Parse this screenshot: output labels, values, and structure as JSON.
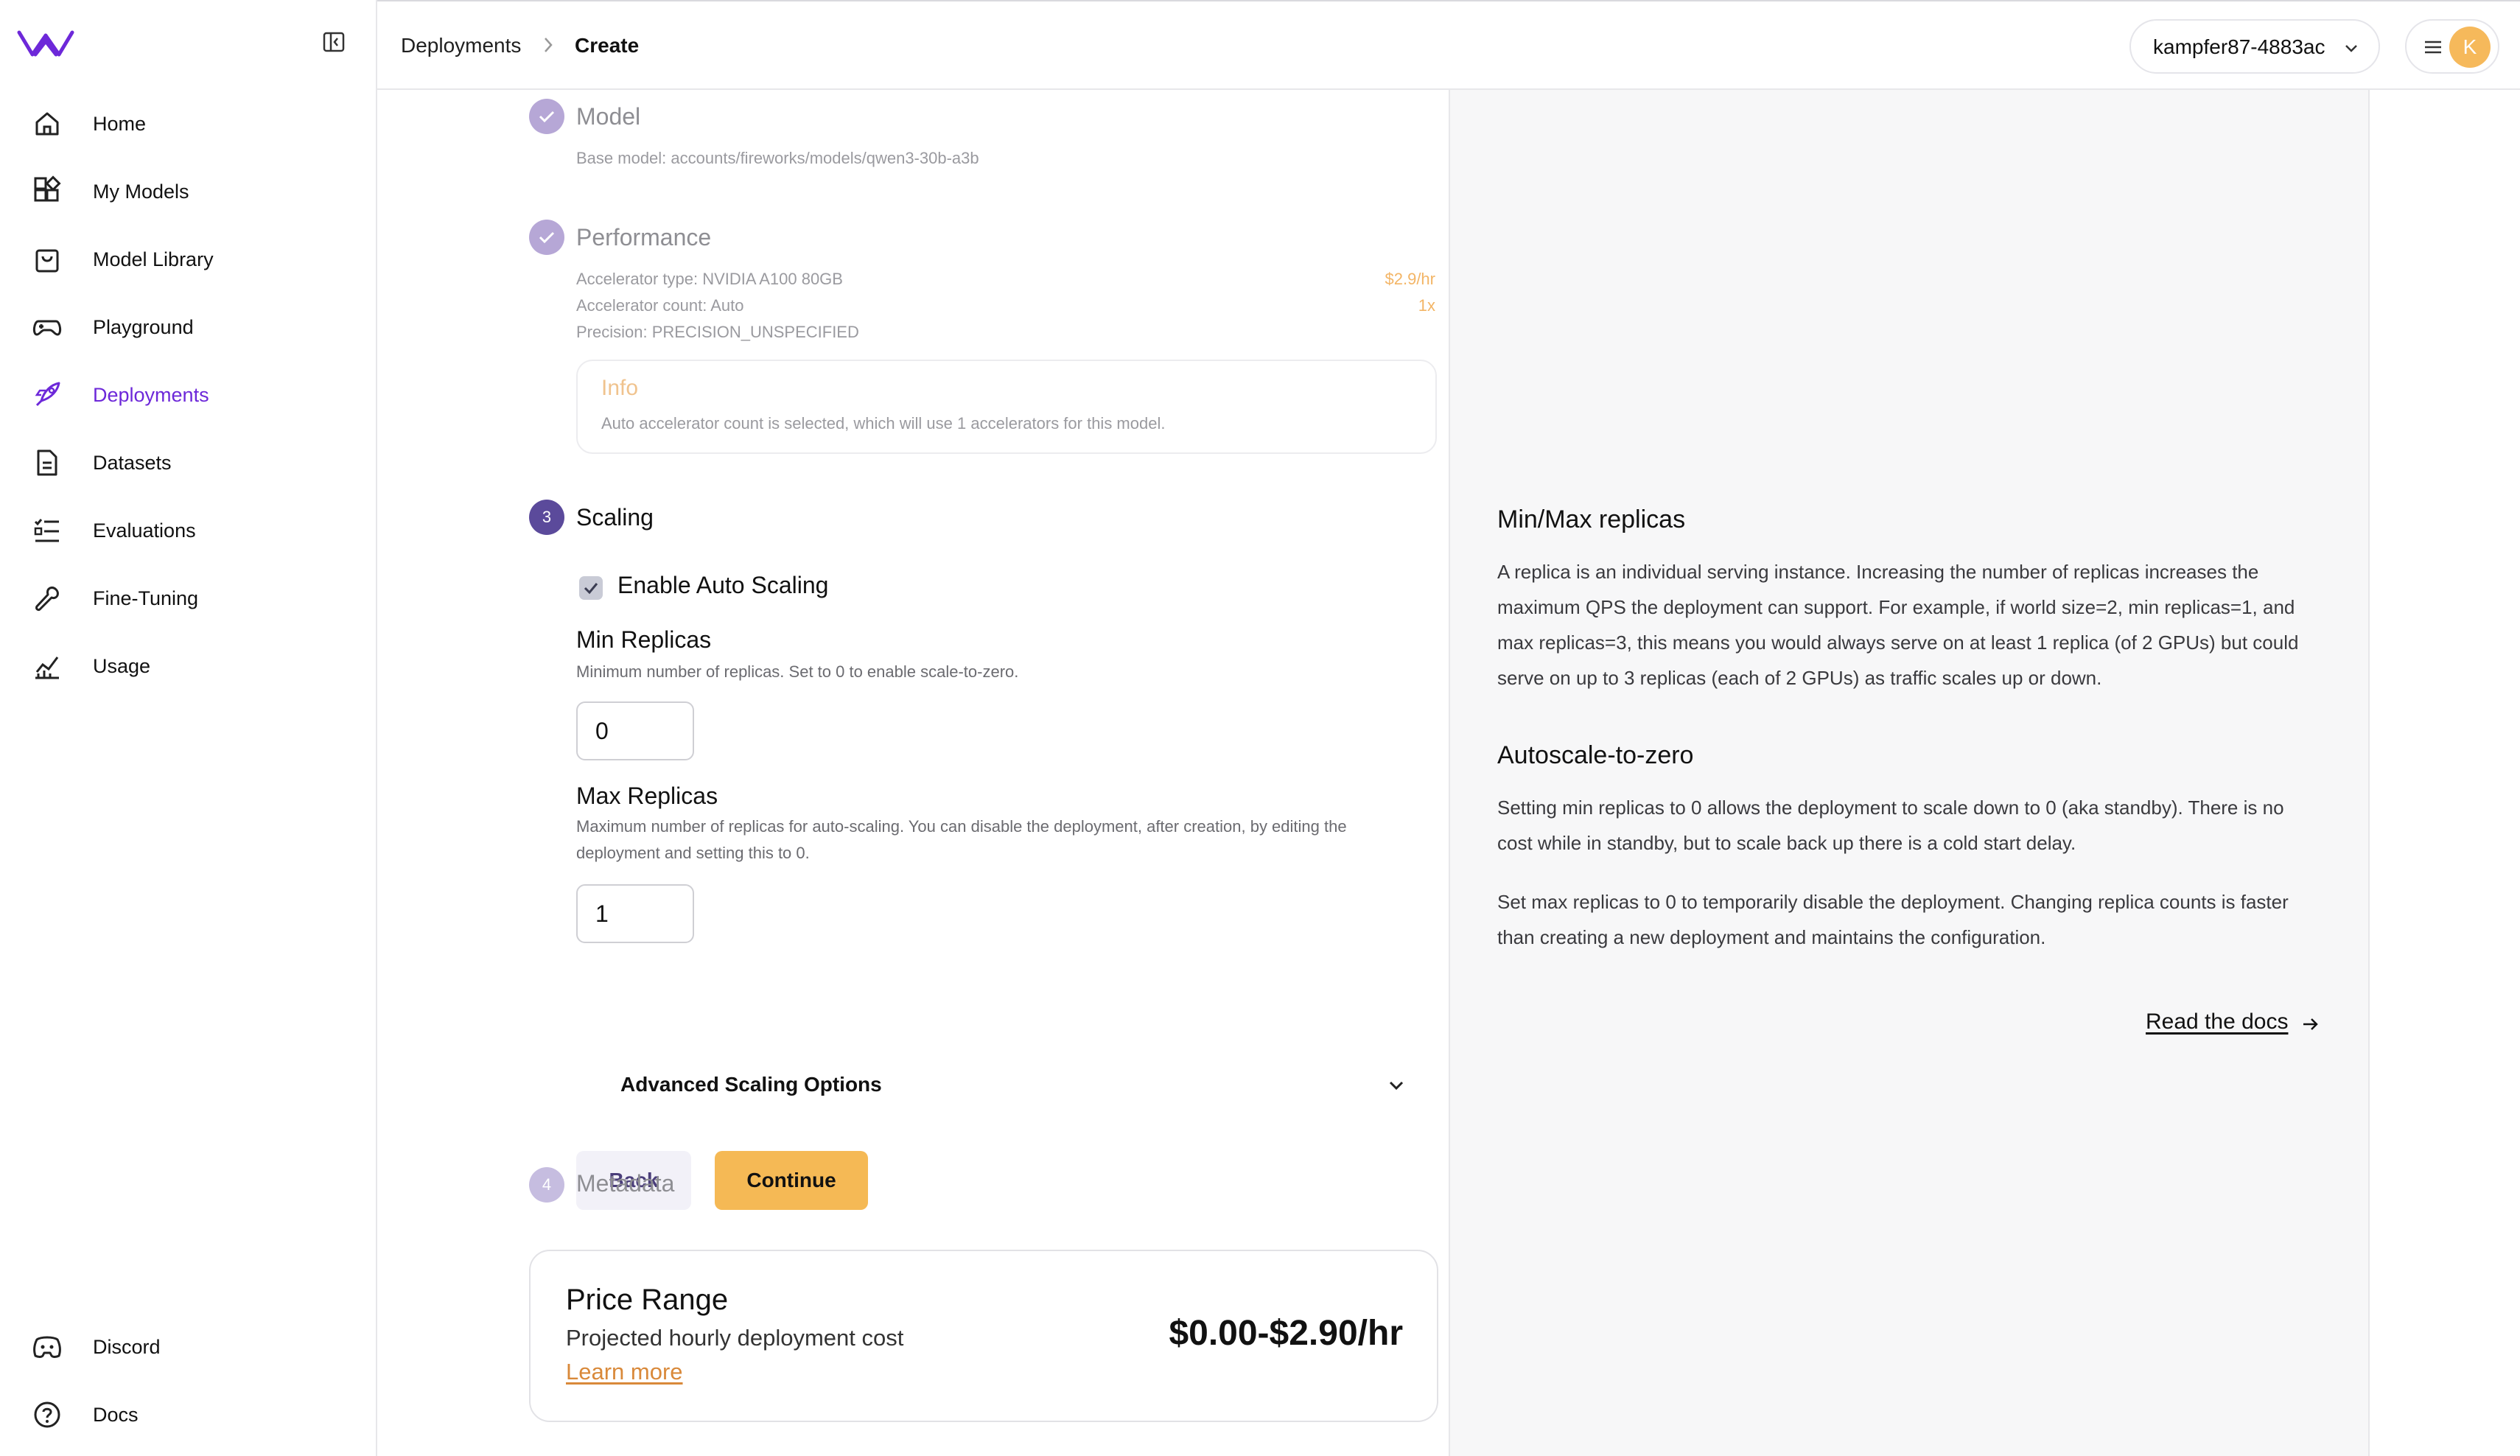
{
  "sidebar": {
    "items": [
      {
        "label": "Home",
        "icon": "home-icon"
      },
      {
        "label": "My Models",
        "icon": "models-icon"
      },
      {
        "label": "Model Library",
        "icon": "bag-icon"
      },
      {
        "label": "Playground",
        "icon": "gamepad-icon"
      },
      {
        "label": "Deployments",
        "icon": "rocket-icon",
        "active": true
      },
      {
        "label": "Datasets",
        "icon": "document-icon"
      },
      {
        "label": "Evaluations",
        "icon": "checklist-icon"
      },
      {
        "label": "Fine-Tuning",
        "icon": "wrench-icon"
      },
      {
        "label": "Usage",
        "icon": "chart-icon"
      }
    ],
    "footer": [
      {
        "label": "Discord",
        "icon": "discord-icon"
      },
      {
        "label": "Docs",
        "icon": "help-circle-icon"
      }
    ]
  },
  "topbar": {
    "breadcrumb": [
      "Deployments",
      "Create"
    ],
    "account": "kampfer87-4883ac",
    "avatar_initial": "K"
  },
  "steps": {
    "model": {
      "title": "Model",
      "base_model": "Base model: accounts/fireworks/models/qwen3-30b-a3b"
    },
    "performance": {
      "title": "Performance",
      "accelerator_type": "Accelerator type: NVIDIA A100 80GB",
      "accelerator_price": "$2.9/hr",
      "accelerator_count": "Accelerator count: Auto",
      "accelerator_count_value": "1x",
      "precision": "Precision: PRECISION_UNSPECIFIED",
      "info_title": "Info",
      "info_text": "Auto accelerator count is selected, which will use 1 accelerators for this model."
    },
    "scaling": {
      "number": "3",
      "title": "Scaling",
      "auto_scaling_label": "Enable Auto Scaling",
      "auto_scaling_checked": true,
      "min_title": "Min Replicas",
      "min_desc": "Minimum number of replicas. Set to 0 to enable scale-to-zero.",
      "min_value": "0",
      "max_title": "Max Replicas",
      "max_desc": "Maximum number of replicas for auto-scaling. You can disable the deployment, after creation, by editing the deployment and setting this to 0.",
      "max_value": "1",
      "advanced": "Advanced Scaling Options",
      "back": "Back",
      "continue": "Continue"
    },
    "metadata": {
      "number": "4",
      "title": "Metadata"
    }
  },
  "price": {
    "title": "Price Range",
    "subtitle": "Projected hourly deployment cost",
    "learn_more": "Learn more",
    "value": "$0.00-$2.90/hr"
  },
  "help": {
    "h1": "Min/Max replicas",
    "p1": "A replica is an individual serving instance. Increasing the number of replicas increases the maximum QPS the deployment can support. For example, if world size=2, min replicas=1, and max replicas=3, this means you would always serve on at least 1 replica (of 2 GPUs) but could serve on up to 3 replicas (each of 2 GPUs) as traffic scales up or down.",
    "h2": "Autoscale-to-zero",
    "p2": "Setting min replicas to 0 allows the deployment to scale down to 0 (aka standby). There is no cost while in standby, but to scale back up there is a cold start delay.",
    "p3": "Set max replicas to 0 to temporarily disable the deployment. Changing replica counts is faster than creating a new deployment and maintains the configuration.",
    "read_docs": "Read the docs"
  },
  "colors": {
    "accent_purple": "#6d28d9",
    "accent_orange": "#f5b955",
    "step_active": "#5b4a9b"
  }
}
